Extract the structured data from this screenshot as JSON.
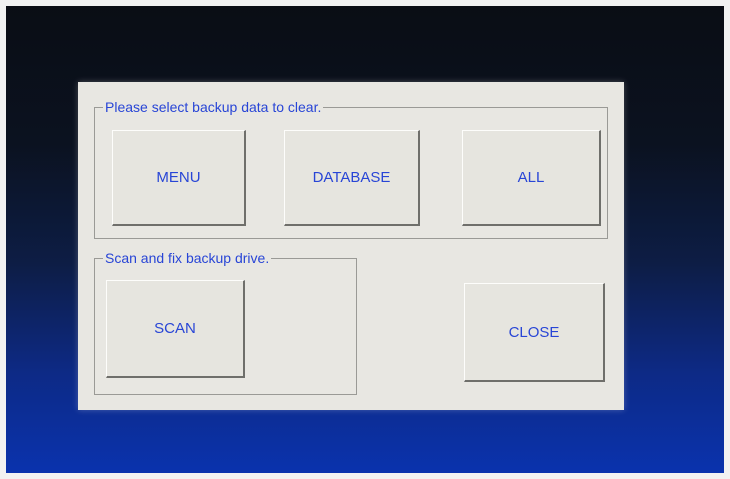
{
  "dialog": {
    "clear_group": {
      "title": "Please select backup data to clear.",
      "buttons": {
        "menu": "MENU",
        "database": "DATABASE",
        "all": "ALL"
      }
    },
    "scan_group": {
      "title": "Scan and fix backup drive.",
      "buttons": {
        "scan": "SCAN"
      }
    },
    "close_label": "CLOSE"
  },
  "colors": {
    "label_text": "#2845d6",
    "dialog_bg": "#e8e7e2",
    "screen_bottom_blue": "#0a33b0"
  }
}
